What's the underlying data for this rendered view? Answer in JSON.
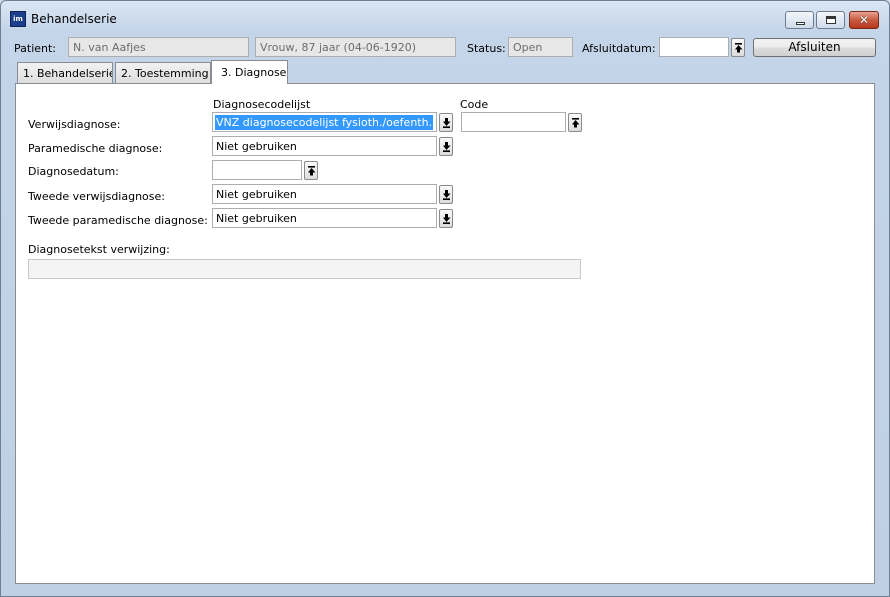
{
  "window": {
    "title": "Behandelserie",
    "app_icon_text": "im"
  },
  "header": {
    "patient_label": "Patient:",
    "patient_name": "N. van Aafjes",
    "patient_details": "Vrouw, 87 jaar (04-06-1920)",
    "status_label": "Status:",
    "status_value": "Open",
    "afsluitdatum_label": "Afsluitdatum:",
    "afsluitdatum_value": "",
    "afsluiten_button": "Afsluiten"
  },
  "tabs": [
    {
      "label": "1. Behandelserie"
    },
    {
      "label": "2. Toestemming"
    },
    {
      "label": "3. Diagnose"
    }
  ],
  "diagnose": {
    "col_codelijst": "Diagnosecodelijst",
    "col_code": "Code",
    "verwijsdiagnose_label": "Verwijsdiagnose:",
    "verwijsdiagnose_value": "VNZ diagnosecodelijst fysioth./oefenth.",
    "code_value": "",
    "paramedische_label": "Paramedische diagnose:",
    "paramedische_value": "Niet gebruiken",
    "diagnosedatum_label": "Diagnosedatum:",
    "diagnosedatum_value": "",
    "tweede_verwijs_label": "Tweede verwijsdiagnose:",
    "tweede_verwijs_value": "Niet gebruiken",
    "tweede_paramedische_label": "Tweede paramedische diagnose:",
    "tweede_paramedische_value": "Niet gebruiken",
    "diagnosetekst_label": "Diagnosetekst verwijzing:",
    "diagnosetekst_value": ""
  },
  "icons": {
    "dropdown": "arrow-down-bar-icon",
    "picker": "arrow-up-bar-icon"
  }
}
